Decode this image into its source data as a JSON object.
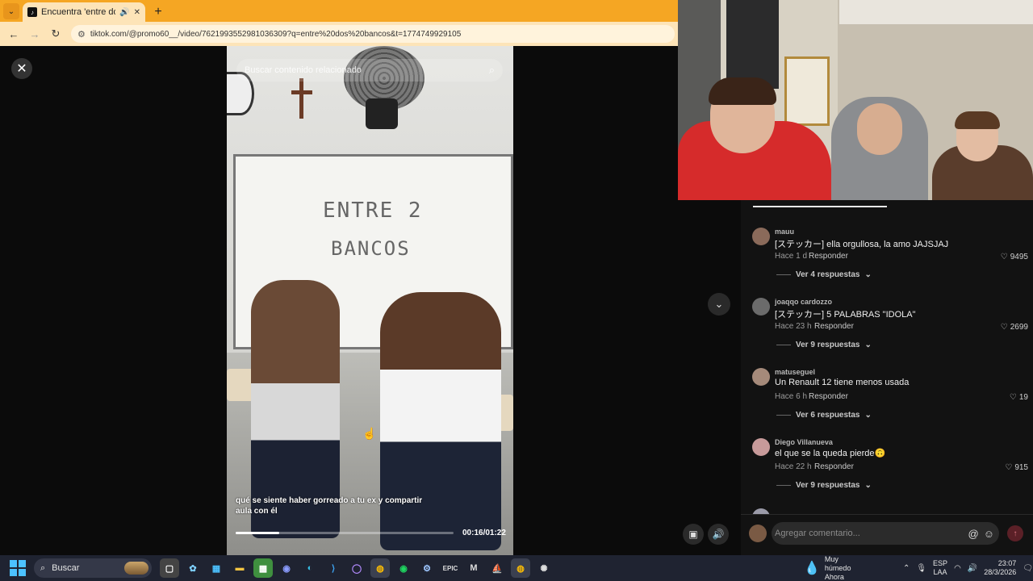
{
  "browser": {
    "tab_title": "Encuentra 'entre dos banco",
    "tab_favicon": "tiktok-icon",
    "url": "tiktok.com/@promo60__/video/7621993552981036309?q=entre%20dos%20bancos&t=1774749929105"
  },
  "video": {
    "search_placeholder": "Buscar contenido relacionado",
    "board_line1": "ENTRE 2",
    "board_line2": "BANCOS",
    "caption": "qué se siente haber gorreado a tu ex y compartir aula con él",
    "time": "00:16/01:22",
    "progress_fraction": 0.2
  },
  "comments": [
    {
      "user": "mauu",
      "text": "[ステッカー] ella orgullosa, la amo JAJSJAJ",
      "time": "Hace 1 d",
      "reply": "Responder",
      "likes": "9495",
      "more": "Ver 4 respuestas",
      "avatar_color": "#8a6a5a"
    },
    {
      "user": "joaqqo cardozzo",
      "text": "[ステッカー] 5 PALABRAS \"IDOLA\"",
      "time": "Hace 23 h",
      "reply": "Responder",
      "likes": "2699",
      "more": "Ver 9 respuestas",
      "avatar_color": "#6b6b6b"
    },
    {
      "user": "matuseguel",
      "text": "Un Renault 12 tiene menos usada",
      "time": "Hace 6 h",
      "reply": "Responder",
      "likes": "19",
      "more": "Ver 6 respuestas",
      "avatar_color": "#a58a7a"
    },
    {
      "user": "Diego Villanueva",
      "text": "el que se la queda pierde🙃",
      "time": "Hace 22 h",
      "reply": "Responder",
      "likes": "915",
      "more": "Ver 9 respuestas",
      "avatar_color": "#c79a9a"
    }
  ],
  "add_comment": {
    "placeholder": "Agregar comentario..."
  },
  "taskbar": {
    "search_label": "Buscar",
    "weather_title": "Muy húmedo",
    "weather_sub": "Ahora",
    "lang_1": "ESP",
    "lang_2": "LAA",
    "time": "23:07",
    "date": "28/3/2026",
    "apps": [
      "task-view",
      "copilot",
      "store",
      "files",
      "minecraft",
      "discord",
      "edge",
      "vscode",
      "github",
      "chrome-alt",
      "spotify",
      "steam",
      "epic",
      "mail",
      "steam-alt",
      "chrome",
      "chatgpt"
    ]
  },
  "colors": {
    "tabbar": "#f5a623",
    "accent_send": "#5b2027",
    "start": "#4cc2ff"
  }
}
